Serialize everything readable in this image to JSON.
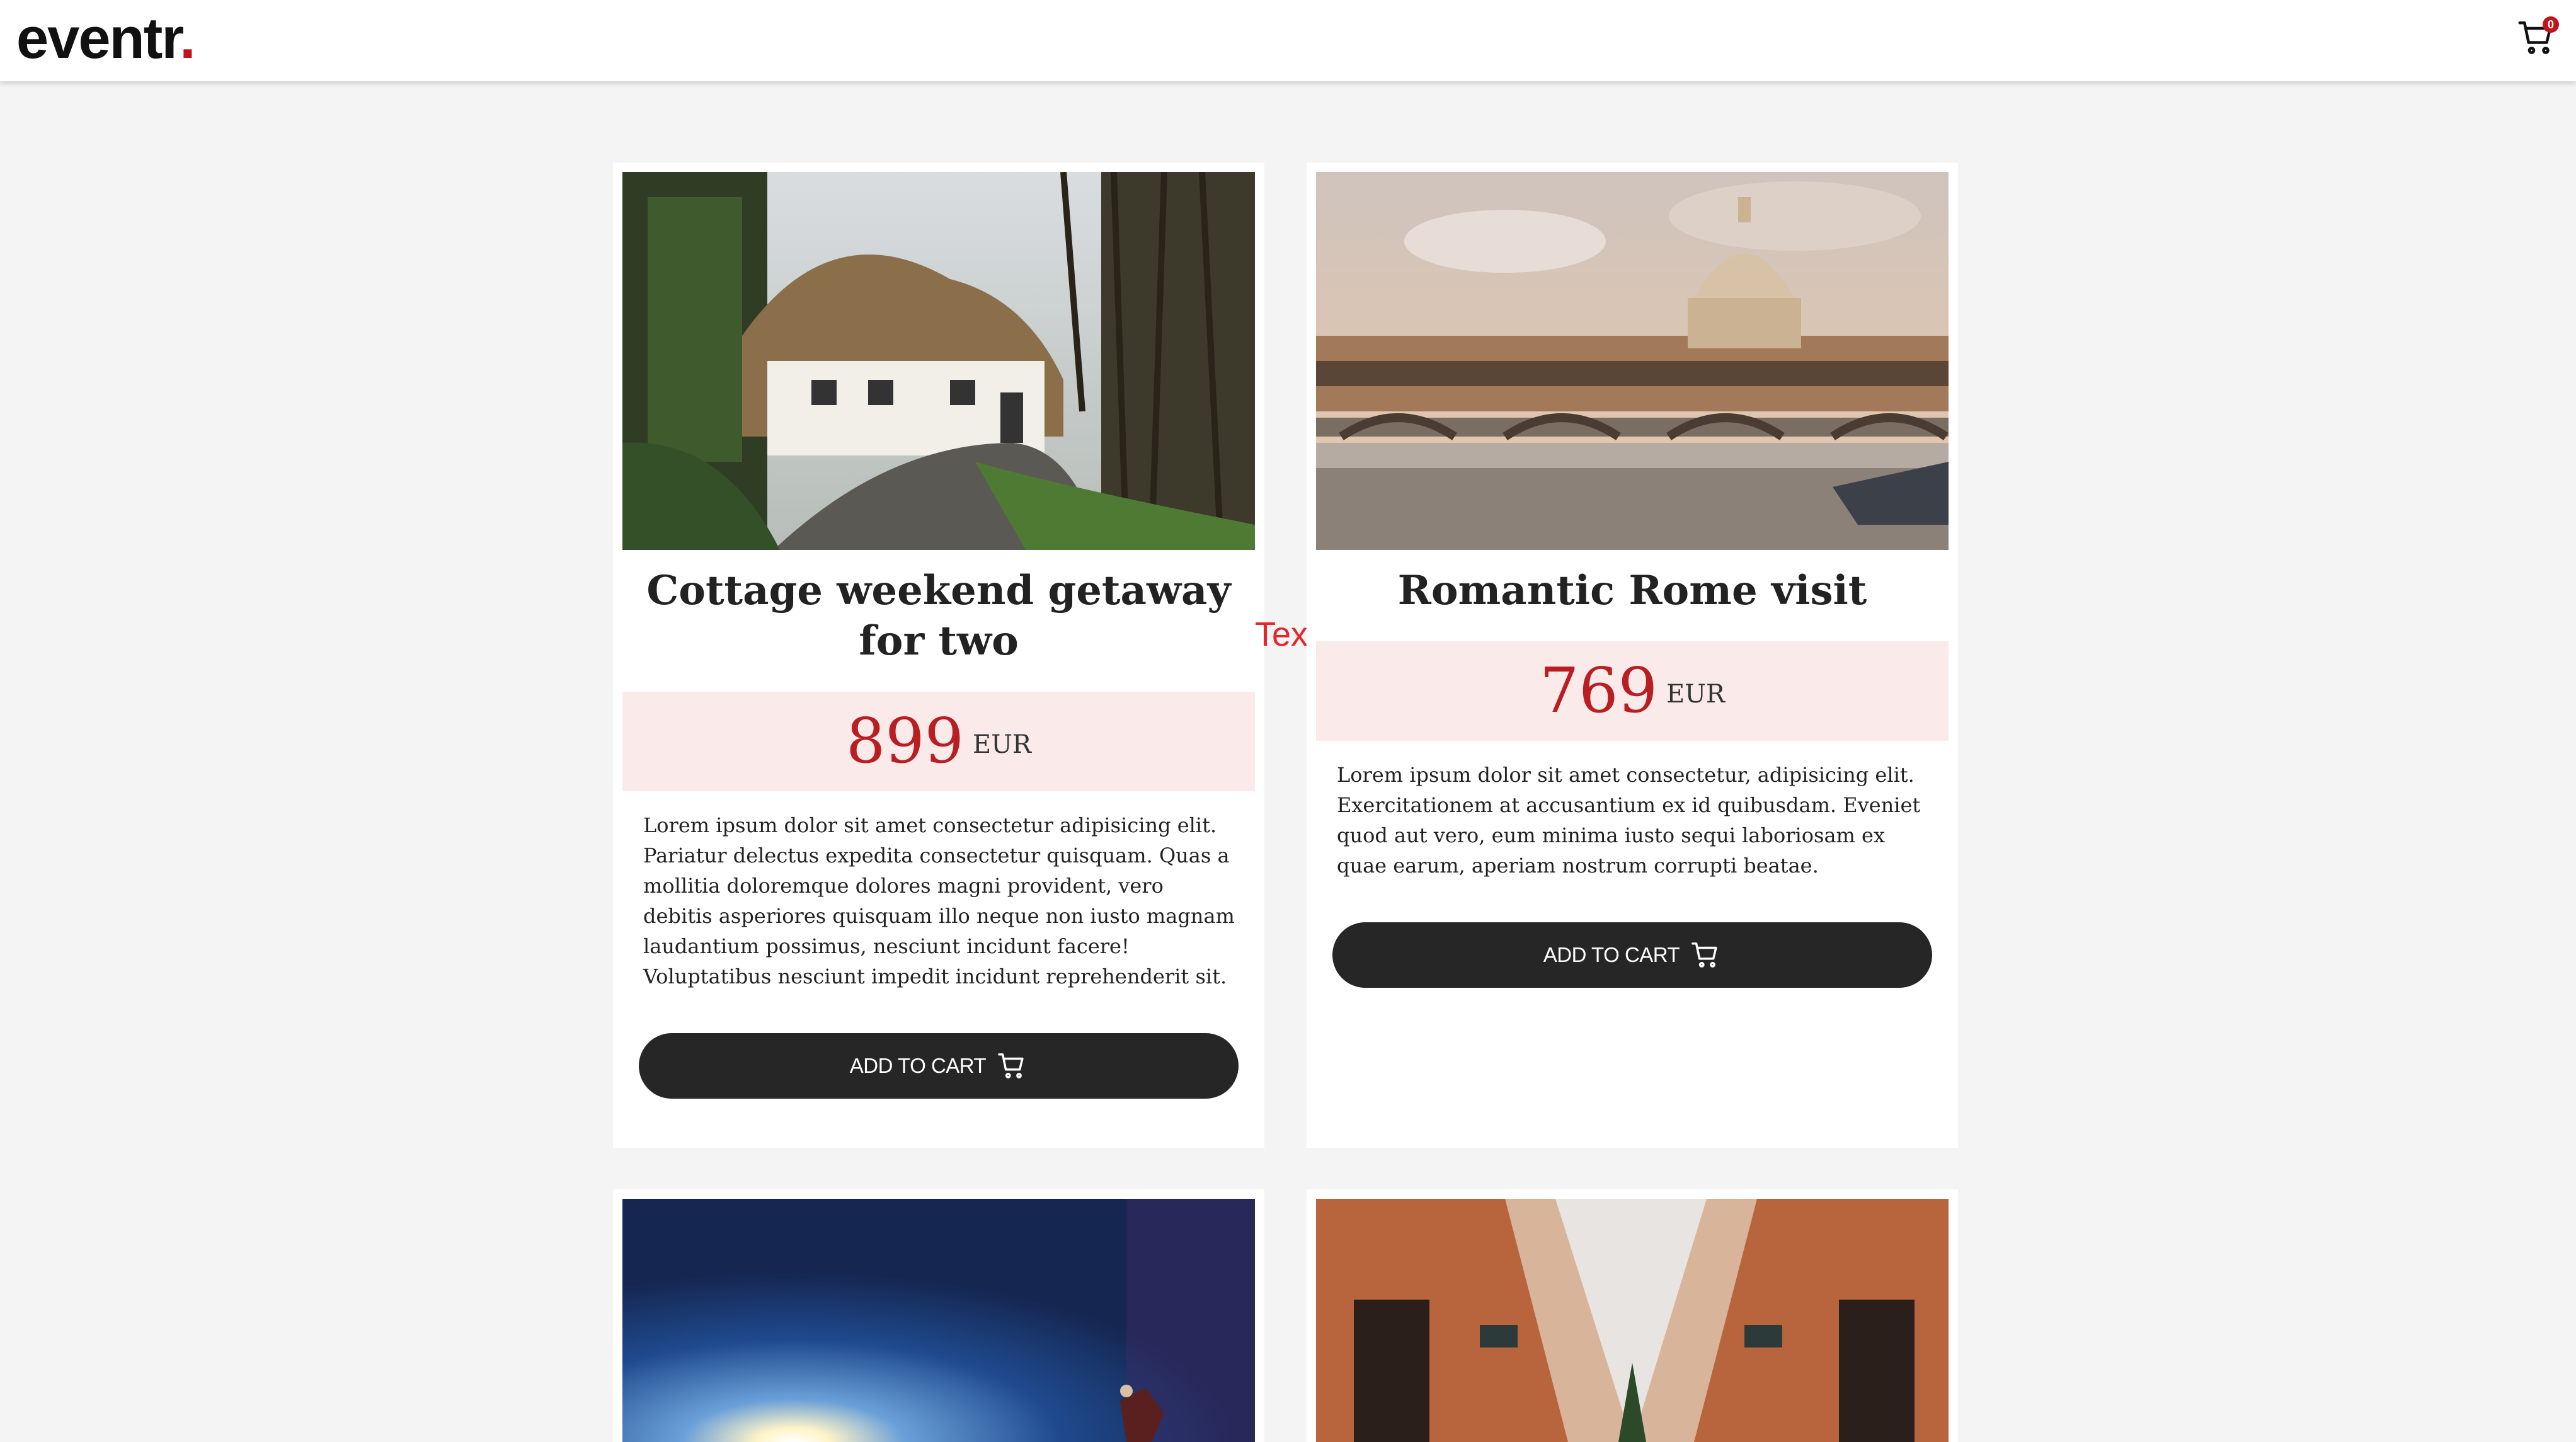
{
  "header": {
    "logo": "eventr",
    "logo_dot": ".",
    "cart_count": "0"
  },
  "annotation": "Text",
  "products": [
    {
      "title": "Cottage weekend getaway for two",
      "price": "899",
      "currency": "EUR",
      "description": "Lorem ipsum dolor sit amet consectetur adipisicing elit. Pariatur delectus expedita consectetur quisquam. Quas a mollitia doloremque dolores magni provident, vero debitis asperiores quisquam illo neque non iusto magnam laudantium possimus, nesciunt incidunt facere! Voluptatibus nesciunt impedit incidunt reprehenderit sit.",
      "button_label": "ADD TO CART"
    },
    {
      "title": "Romantic Rome visit",
      "price": "769",
      "currency": "EUR",
      "description": "Lorem ipsum dolor sit amet consectetur, adipisicing elit. Exercitationem at accusantium ex id quibusdam. Eveniet quod aut vero, eum minima iusto sequi laboriosam ex quae earum, aperiam nostrum corrupti beatae.",
      "button_label": "ADD TO CART"
    }
  ],
  "colors": {
    "accent": "#c0141b",
    "price_band": "#faeaea",
    "button": "#262626"
  }
}
